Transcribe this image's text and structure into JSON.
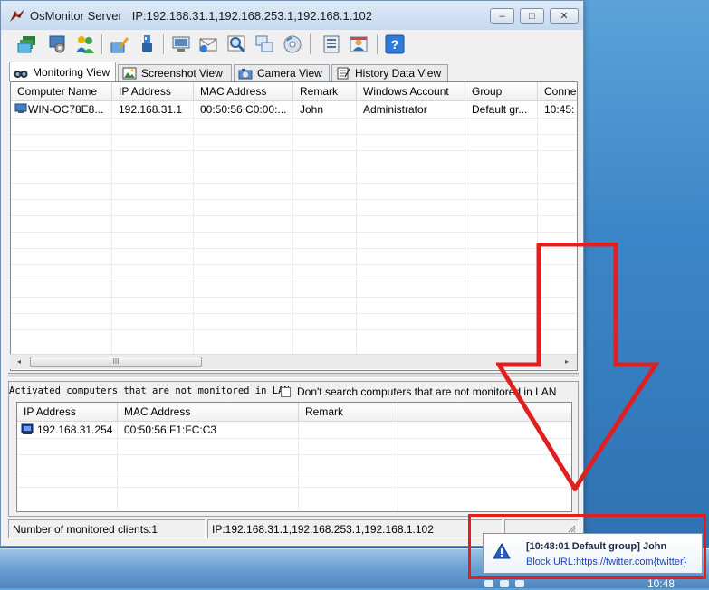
{
  "window": {
    "title": "OsMonitor Server",
    "title_ip": "IP:192.168.31.1,192.168.253.1,192.168.1.102",
    "controls": {
      "minimize": "–",
      "maximize": "□",
      "close": "✕"
    }
  },
  "toolbar": {
    "icons": [
      "monitor-stack-icon",
      "settings-gear-icon",
      "users-icon",
      "edit-group-icon",
      "usb-key-icon",
      "screen-icon",
      "mail-icon",
      "magnifier-icon",
      "windows-icon",
      "disc-icon",
      "report-icon",
      "user-card-icon",
      "help-icon"
    ]
  },
  "tabs": [
    {
      "label": "Monitoring View",
      "icon": "binoculars-icon",
      "active": true
    },
    {
      "label": "Screenshot View",
      "icon": "picture-icon",
      "active": false
    },
    {
      "label": "Camera View",
      "icon": "camera-icon",
      "active": false
    },
    {
      "label": "History Data View",
      "icon": "notepad-icon",
      "active": false
    }
  ],
  "monitored_table": {
    "columns": [
      "Computer Name",
      "IP Address",
      "MAC Address",
      "Remark",
      "Windows Account",
      "Group",
      "Conne"
    ],
    "rows": [
      {
        "computer_name": "WIN-OC78E8...",
        "ip": "192.168.31.1",
        "mac": "00:50:56:C0:00:...",
        "remark": "John",
        "account": "Administrator",
        "group": "Default gr...",
        "connect": "10:45:"
      }
    ]
  },
  "scrollbar": {
    "left": "◂",
    "right": "▸",
    "thumb_grip": "III"
  },
  "lan_panel": {
    "label": "Activated computers that are not monitored in LAN",
    "checkbox_label": "Don't search computers that are not monitored in LAN",
    "checkbox_checked": false,
    "columns": [
      "IP Address",
      "MAC Address",
      "Remark"
    ],
    "rows": [
      {
        "ip": "192.168.31.254",
        "mac": "00:50:56:F1:FC:C3",
        "remark": ""
      }
    ]
  },
  "status_bar": {
    "clients": "Number of monitored clients:1",
    "ips": "IP:192.168.31.1,192.168.253.1,192.168.1.102"
  },
  "notification": {
    "title": "[10:48:01 Default group] John",
    "text": "Block URL:https://twitter.com{twitter}"
  },
  "taskbar": {
    "clock": "10:48"
  },
  "colors": {
    "highlight_red": "#e02020",
    "link_blue": "#1747c2",
    "taskbar_blue": "#4e86bf"
  }
}
